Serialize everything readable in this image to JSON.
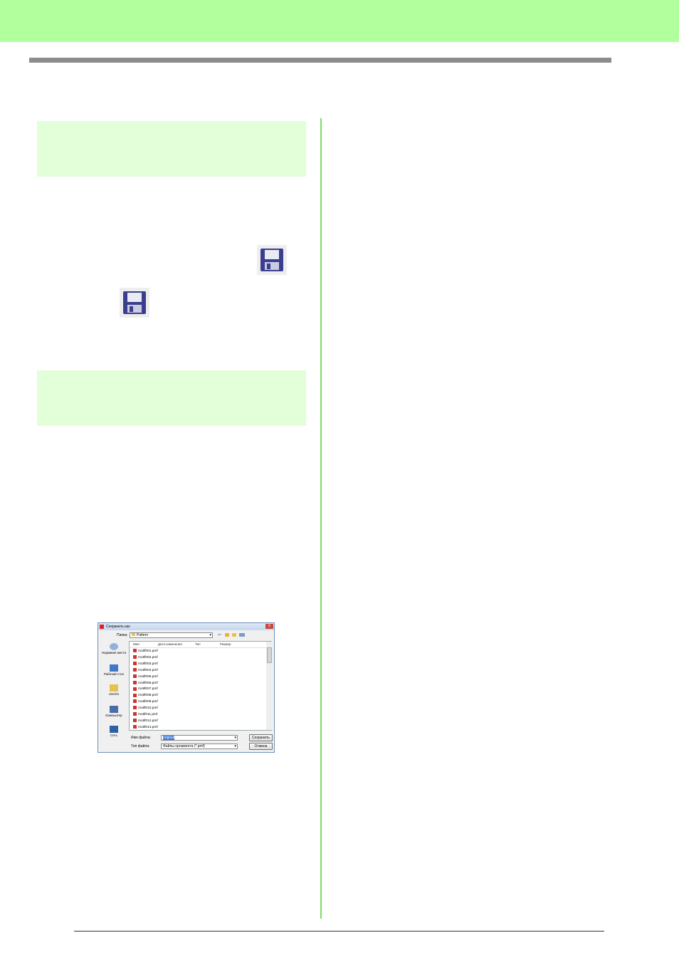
{
  "colors": {
    "top_band": "#b2ff9e",
    "section_box": "#e2ffda",
    "divider": "#7bdc6a",
    "title_rule": "#8c8c8c"
  },
  "icons": [
    "save-icon",
    "save-icon"
  ],
  "dialog": {
    "title": "Сохранить как",
    "close": "x",
    "folder_label": "Папка:",
    "folder_value": "Pattern",
    "places": [
      {
        "label": "Недавние места",
        "icon": "recent-places-icon"
      },
      {
        "label": "Рабочий стол",
        "icon": "desktop-icon"
      },
      {
        "label": "User01",
        "icon": "user-folder-icon"
      },
      {
        "label": "Компьютер",
        "icon": "computer-icon"
      },
      {
        "label": "Сеть",
        "icon": "network-icon"
      }
    ],
    "columns": [
      "Имя",
      "Дата изменения",
      "Тип",
      "Размер"
    ],
    "files": [
      "motif001.pmf",
      "motif002.pmf",
      "motif003.pmf",
      "motif004.pmf",
      "motif005.pmf",
      "motif006.pmf",
      "motif007.pmf",
      "motif008.pmf",
      "motif009.pmf",
      "motif010.pmf",
      "motif011.pmf",
      "motif012.pmf",
      "motif013.pmf"
    ],
    "filename_label": "Имя файла:",
    "filename_value": "original",
    "filetype_label": "Тип файла:",
    "filetype_value": "Файлы орнамента (*.pmf)",
    "save_button": "Сохранить",
    "cancel_button": "Отмена"
  }
}
